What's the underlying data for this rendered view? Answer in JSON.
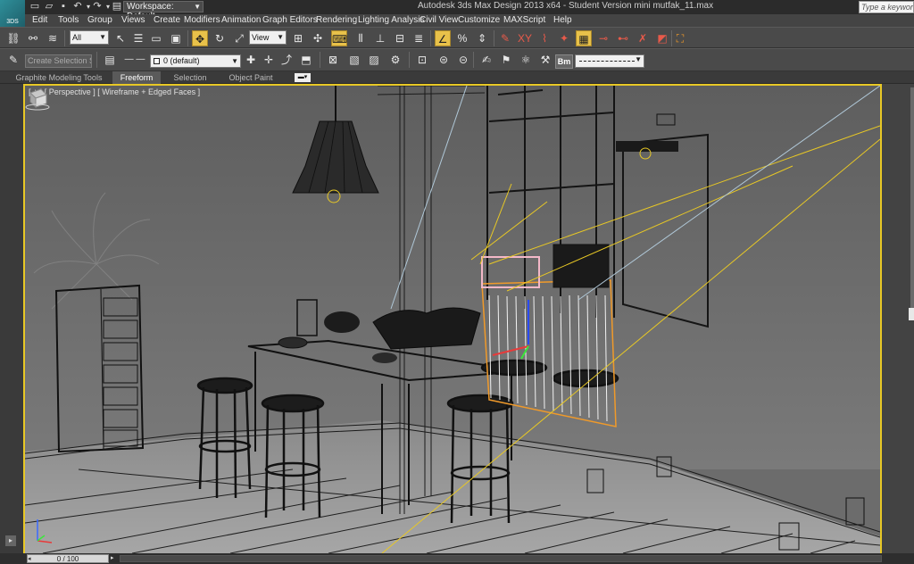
{
  "title_bar": {
    "workspace_label": "Workspace: Default",
    "window_title": "Autodesk 3ds Max Design 2013 x64  -  Student Version    mini mutfak_11.max",
    "help_search_placeholder": "Type a keyword or"
  },
  "logo_text": "3DS",
  "menu": [
    "Edit",
    "Tools",
    "Group",
    "Views",
    "Create",
    "Modifiers",
    "Animation",
    "Graph Editors",
    "Rendering",
    "Lighting Analysis",
    "Civil View",
    "Customize",
    "MAXScript",
    "Help"
  ],
  "toolbar1": {
    "selection_filter": "All",
    "reference_coord": "View"
  },
  "toolbar2": {
    "named_selection_placeholder": "Create Selection Se",
    "layer_name": "0 (default)",
    "bm_label": "Bm"
  },
  "ribbon": {
    "tabs": [
      "Graphite Modeling Tools",
      "Freeform",
      "Selection",
      "Object Paint"
    ],
    "active_tab": "Freeform"
  },
  "viewport": {
    "label": "[ + ] [ Perspective ] [ Wireframe + Edged Faces ]"
  },
  "timeline": {
    "frame_display": "0 / 100"
  },
  "colors": {
    "accent_highlight": "#e8c825",
    "viewport_bg": "#6c6c6c",
    "selection_orange": "#f09a2a"
  }
}
